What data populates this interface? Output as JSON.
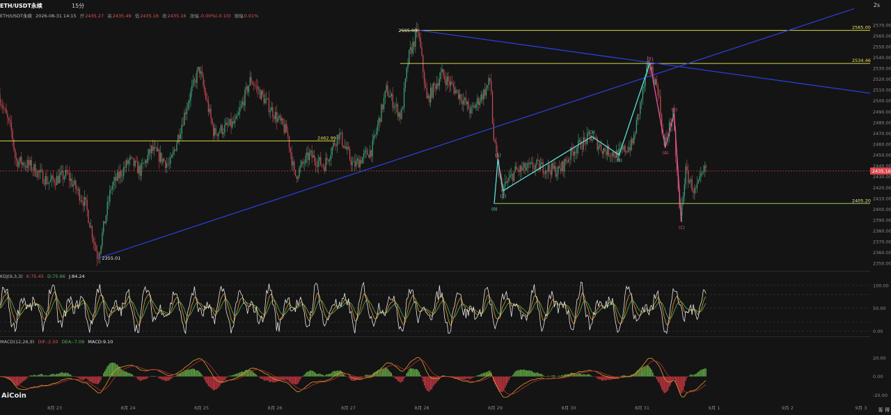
{
  "header": {
    "symbol": "ETH/USDT永续",
    "timeframe": "15分",
    "right_label": "2s"
  },
  "ohlc_line": {
    "symbol": "ETH/USDT永续",
    "datetime": "2026-08-31 14:15",
    "open_label": "开",
    "open": "2435.27",
    "high_label": "高",
    "high": "2435.49",
    "low_label": "低",
    "low": "2435.16",
    "close_label": "收",
    "close": "2435.16",
    "change_label": "涨幅",
    "change": "-0.00%(-0.10)",
    "amp_label": "振幅",
    "amp": "0.01%"
  },
  "kdj": {
    "name": "KDJ(9,3,3)",
    "k_label": "K",
    "k": "75.45",
    "d_label": "D",
    "d": "75.66",
    "j_label": "J",
    "j": "84.24"
  },
  "macd": {
    "name": "MACD(12,26,9)",
    "dif_label": "DIF",
    "dif": "-2.50",
    "dea_label": "DEA",
    "dea": "-7.09",
    "macd_label": "MACD",
    "macd": "9.10"
  },
  "watermark": "AiCoin",
  "corner": "筹 得",
  "colors": {
    "up": "#3fa57a",
    "down": "#c94a55",
    "trendline": "#2a3fd6",
    "hline": "#d8d84a",
    "wave_cyan": "#5fe0d8",
    "wave_pink": "#e05a9a",
    "support": "#9ad05a",
    "price_tag": "#e04850"
  },
  "chart_data": [
    {
      "type": "candlestick",
      "price_axis_ticks": [
        2350,
        2360,
        2370,
        2380,
        2390,
        2400,
        2410,
        2420,
        2430,
        2440,
        2450,
        2460,
        2470,
        2480,
        2490,
        2500,
        2510,
        2520,
        2530,
        2540,
        2550,
        2560,
        2570
      ],
      "ylim": [
        2345,
        2575
      ],
      "x_ticks": [
        "8月 23",
        "8月 24",
        "8月 25",
        "8月 26",
        "8月 27",
        "8月 28",
        "8月 29",
        "8月 30",
        "8月 31",
        "9月 1",
        "9月 2",
        "9月 3"
      ],
      "current_price": "2435.16",
      "horizontal_levels": [
        {
          "value": "2565.00",
          "kind": "resistance"
        },
        {
          "value": "2534.46",
          "kind": "resistance"
        },
        {
          "value": "2462.99",
          "kind": "mid"
        },
        {
          "value": "2405.20",
          "kind": "support"
        }
      ],
      "extreme_labels": [
        {
          "value": "2565.00",
          "at": "8月 28"
        },
        {
          "value": "2355.01",
          "at": "8月 23"
        }
      ],
      "wave_labels": [
        "(0)",
        "(1)",
        "(2)",
        "(3)",
        "(4)",
        "(5)",
        "(A)",
        "(B)",
        "(C)"
      ],
      "wave_points": [
        {
          "label": "(0)",
          "day": 6.0,
          "price": 2405
        },
        {
          "label": "(1)",
          "day": 6.05,
          "price": 2446
        },
        {
          "label": "(2)",
          "day": 6.12,
          "price": 2417
        },
        {
          "label": "(3)",
          "day": 7.33,
          "price": 2467
        },
        {
          "label": "(4)",
          "day": 7.7,
          "price": 2450
        },
        {
          "label": "(5)",
          "day": 8.12,
          "price": 2535
        },
        {
          "label": "(A)",
          "day": 8.33,
          "price": 2457
        },
        {
          "label": "(B)",
          "day": 8.45,
          "price": 2488
        },
        {
          "label": "(C)",
          "day": 8.55,
          "price": 2388
        }
      ]
    },
    {
      "type": "line",
      "name": "KDJ(9,3,3)",
      "axis_ticks": [
        "100.00",
        "50.00",
        "0.00"
      ],
      "ylim": [
        -10,
        115
      ]
    },
    {
      "type": "bar",
      "name": "MACD(12,26,9)",
      "axis_ticks": [
        "20.00",
        "0.00",
        "-20.00"
      ],
      "ylim": [
        -28,
        35
      ]
    }
  ]
}
